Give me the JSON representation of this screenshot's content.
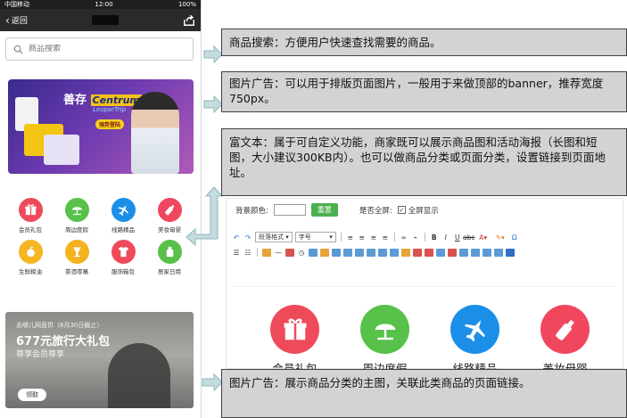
{
  "phone": {
    "status": {
      "carrier": "中国移动",
      "time": "12:00",
      "battery": "100%"
    },
    "nav": {
      "back_label": "返回"
    },
    "search": {
      "placeholder": "商品搜索"
    },
    "banner": {
      "brand_cn": "善存",
      "brand_en": "Centrum",
      "sub": "LeoparTrip",
      "cta": "强势登陆"
    },
    "icons": [
      {
        "label": "会员礼包",
        "color": "#ef4a5a",
        "icon": "gift-icon"
      },
      {
        "label": "周边度假",
        "color": "#57c14a",
        "icon": "umbrella-icon"
      },
      {
        "label": "线路精品",
        "color": "#1b8ee8",
        "icon": "airplane-icon"
      },
      {
        "label": "美妆母婴",
        "color": "#f0475f",
        "icon": "bottle-icon"
      },
      {
        "label": "生鲜粮油",
        "color": "#f6b522",
        "icon": "fruit-icon"
      },
      {
        "label": "茶酒零嘴",
        "color": "#f3b21f",
        "icon": "drink-icon"
      },
      {
        "label": "服饰箱包",
        "color": "#ef4a5a",
        "icon": "tshirt-icon"
      },
      {
        "label": "居家日用",
        "color": "#57c14a",
        "icon": "home-goods-icon"
      }
    ],
    "promo": {
      "line1": "去哪儿网直供（6月30日截止）",
      "line2": "677元旅行大礼包",
      "line3": "尊享会员尊享",
      "claim": "领取"
    }
  },
  "callouts": {
    "search": "商品搜索：方便用户快速查找需要的商品。",
    "banner": "图片广告：可以用于排版页面图片，一般用于来做顶部的banner，推荐宽度750px。",
    "richtext": "富文本：属于可自定义功能，商家既可以展示商品图和活动海报（长图和短图，大小建议300KB内）。也可以做商品分类或页面分类，设置链接到页面地址。",
    "category": "图片广告：展示商品分类的主图，关联此类商品的页面链接。"
  },
  "editor": {
    "bg_color_label": "背景颜色:",
    "reset_label": "重置",
    "fullscreen_label": "是否全屏:",
    "fullscreen_checkbox_label": "全屏显示",
    "paragraph_select": "段落格式",
    "fontsize_select": "字号",
    "big_icons": [
      {
        "label": "会员礼包",
        "color": "#ef4a5a",
        "icon": "gift-icon"
      },
      {
        "label": "周边度假",
        "color": "#57c14a",
        "icon": "umbrella-icon"
      },
      {
        "label": "线路精品",
        "color": "#1b8ee8",
        "icon": "airplane-icon"
      },
      {
        "label": "美妆母婴",
        "color": "#f0475f",
        "icon": "bottle-icon"
      }
    ]
  },
  "colors": {
    "arrow_fill": "#c4dcdf",
    "arrow_stroke": "#8fb5ba",
    "callout_bg": "#d3d3d3"
  }
}
